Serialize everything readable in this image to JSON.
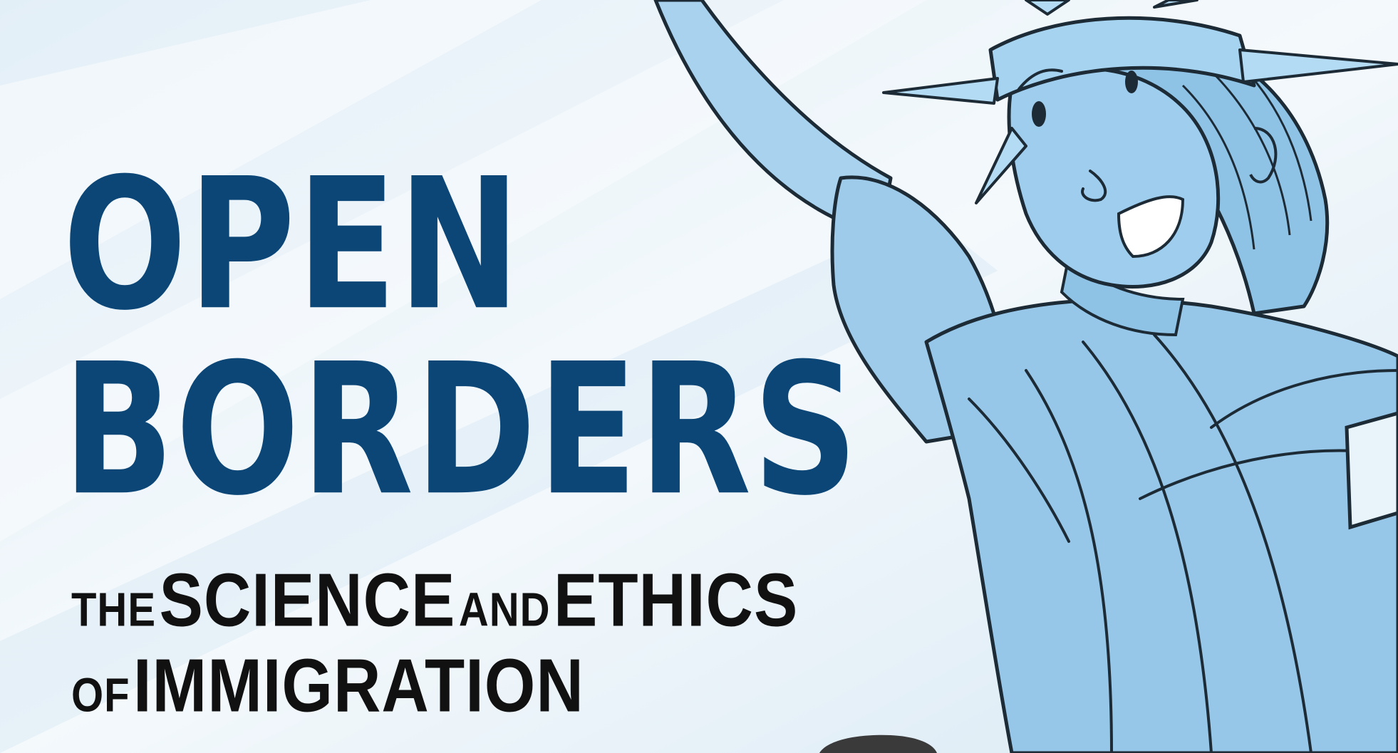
{
  "cover": {
    "title_line1": "OPEN",
    "title_line2": "BORDERS",
    "subtitle_line1": {
      "w1": "THE",
      "w2": "SCIENCE",
      "w3": "AND",
      "w4": "ETHICS"
    },
    "subtitle_line2": {
      "w1": "OF",
      "w2": "IMMIGRATION"
    }
  },
  "colors": {
    "title": "#0b4677",
    "subtitle": "#111111",
    "statue_fill": "#8fc3e6",
    "statue_line": "#1c2b36",
    "background": "#eef5fa"
  },
  "icons": {
    "illustration": "statue-of-liberty-cartoon"
  }
}
